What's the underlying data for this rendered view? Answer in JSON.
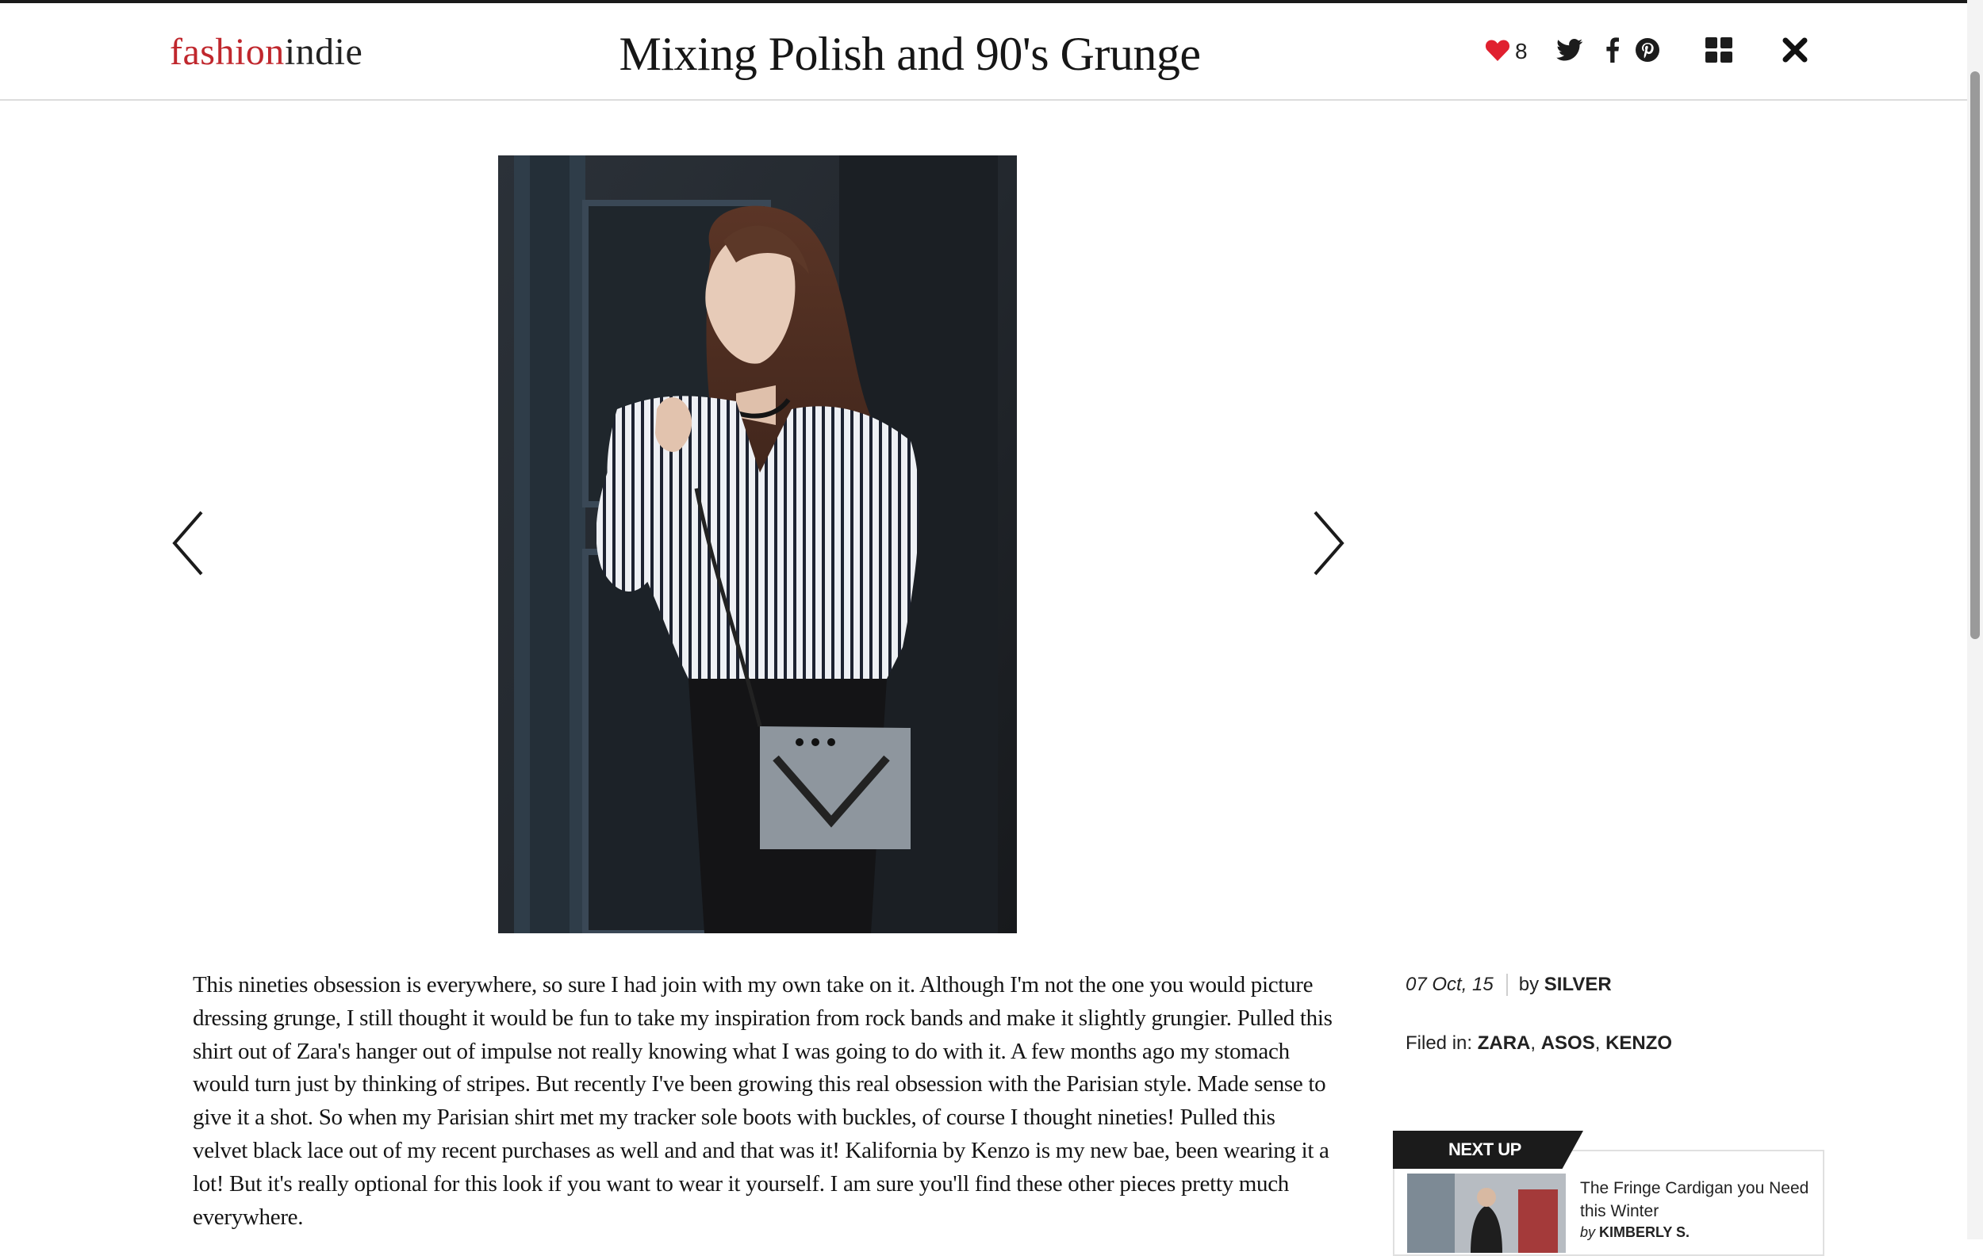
{
  "header": {
    "logo_part1": "fashion",
    "logo_part2": "indie",
    "title": "Mixing Polish and 90's Grunge",
    "likes_count": "8",
    "icons": [
      "heart-icon",
      "twitter-icon",
      "facebook-icon",
      "pinterest-icon",
      "grid-icon",
      "close-icon"
    ],
    "colors": {
      "brand_red": "#c0272d",
      "like_red": "#e0202f"
    }
  },
  "gallery": {
    "image_alt": "Woman in a striped shirt with a grey crossbody bag",
    "prev_icon": "chevron-left-icon",
    "next_icon": "chevron-right-icon"
  },
  "article": {
    "body": "This nineties obsession is everywhere, so sure I had join with my own take on it. Although I'm not the one you would picture dressing grunge, I still thought it would be fun to take my inspiration from rock bands and make it slightly grungier. Pulled this shirt out of Zara's hanger out of impulse not really knowing what I was going to do with it. A few months ago my stomach would turn just by thinking of stripes. But recently I've been growing this real obsession with the Parisian style. Made sense to give it a shot. So when my Parisian shirt met my tracker sole boots with buckles, of course I thought nineties! Pulled this velvet black lace out of my recent purchases as well and and that was it! Kalifornia by Kenzo is my new bae, been wearing it a lot! But it's really optional for this look if you want to wear it yourself. I am sure you'll find these other pieces pretty much everywhere."
  },
  "meta": {
    "date": "07 Oct, 15",
    "by_label": "by",
    "author": "SILVER",
    "filed_label": "Filed in:",
    "tags": [
      "ZARA",
      "ASOS",
      "KENZO"
    ]
  },
  "next_up": {
    "label": "NEXT UP",
    "title": "The Fringe Cardigan you Need this Winter",
    "by_label": "by",
    "author": "KIMBERLY S."
  }
}
